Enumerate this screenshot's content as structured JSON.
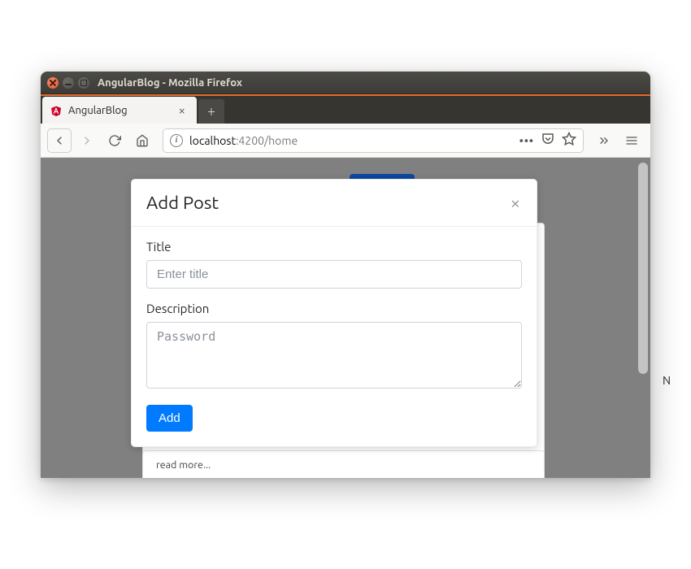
{
  "window": {
    "title": "AngularBlog - Mozilla Firefox"
  },
  "tab": {
    "title": "AngularBlog"
  },
  "url": {
    "host": "localhost",
    "path": ":4200/home"
  },
  "modal": {
    "title": "Add Post",
    "title_label": "Title",
    "title_placeholder": "Enter title",
    "desc_label": "Description",
    "desc_placeholder": "Password",
    "submit_label": "Add"
  },
  "page": {
    "read_more": "read more..."
  },
  "overflow_char": "N"
}
